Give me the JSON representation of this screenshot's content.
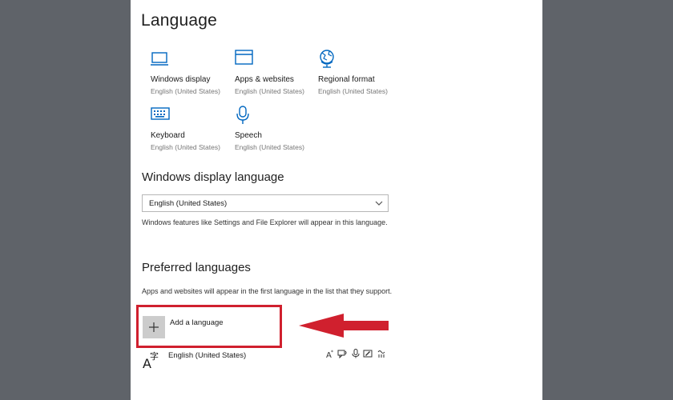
{
  "page": {
    "title": "Language"
  },
  "tiles": [
    {
      "title": "Windows display",
      "subtitle": "English (United States)",
      "icon": "monitor-icon"
    },
    {
      "title": "Apps & websites",
      "subtitle": "English (United States)",
      "icon": "window-icon"
    },
    {
      "title": "Regional format",
      "subtitle": "English (United States)",
      "icon": "globe-icon"
    },
    {
      "title": "Keyboard",
      "subtitle": "English (United States)",
      "icon": "keyboard-icon"
    },
    {
      "title": "Speech",
      "subtitle": "English (United States)",
      "icon": "microphone-icon"
    }
  ],
  "display_language": {
    "heading": "Windows display language",
    "selected": "English (United States)",
    "description": "Windows features like Settings and File Explorer will appear in this language."
  },
  "preferred": {
    "heading": "Preferred languages",
    "description": "Apps and websites will appear in the first language in the list that they support.",
    "add_label": "Add a language",
    "languages": [
      {
        "name": "English (United States)",
        "features": [
          "display-language-icon",
          "text-to-speech-icon",
          "speech-recognition-icon",
          "handwriting-icon",
          "basic-typing-icon"
        ]
      }
    ]
  },
  "colors": {
    "accent": "#0067c0",
    "highlight": "#d0202e"
  }
}
